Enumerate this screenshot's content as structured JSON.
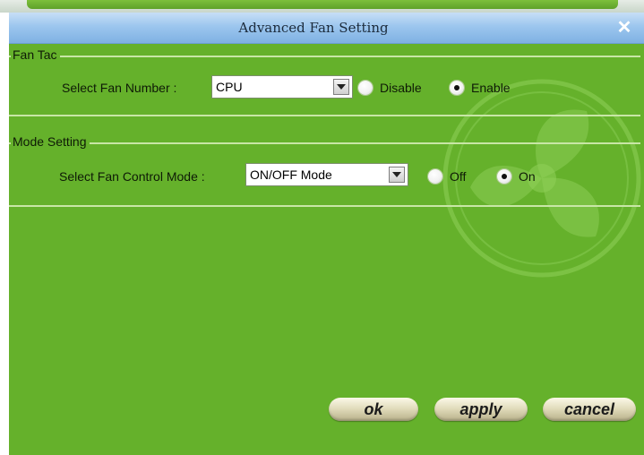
{
  "window": {
    "title": "Advanced Fan Setting",
    "close_glyph": "✕"
  },
  "fan_tac": {
    "legend": "Fan Tac",
    "select_label": "Select Fan Number :",
    "selected_fan": "CPU",
    "options": {
      "disable_label": "Disable",
      "enable_label": "Enable",
      "selected": "Enable"
    }
  },
  "mode_setting": {
    "legend": "Mode Setting",
    "select_label": "Select Fan Control Mode :",
    "selected_mode": "ON/OFF Mode",
    "options": {
      "off_label": "Off",
      "on_label": "On",
      "selected": "On"
    }
  },
  "buttons": {
    "ok": "ok",
    "apply": "apply",
    "cancel": "cancel"
  },
  "icons": {
    "dropdown": "chevron-down-icon",
    "close": "close-icon",
    "watermark": "fan-icon"
  },
  "colors": {
    "panel": "#65b12b",
    "titlebar": "#9cc6ee",
    "group_border": "#c8e6a6"
  }
}
